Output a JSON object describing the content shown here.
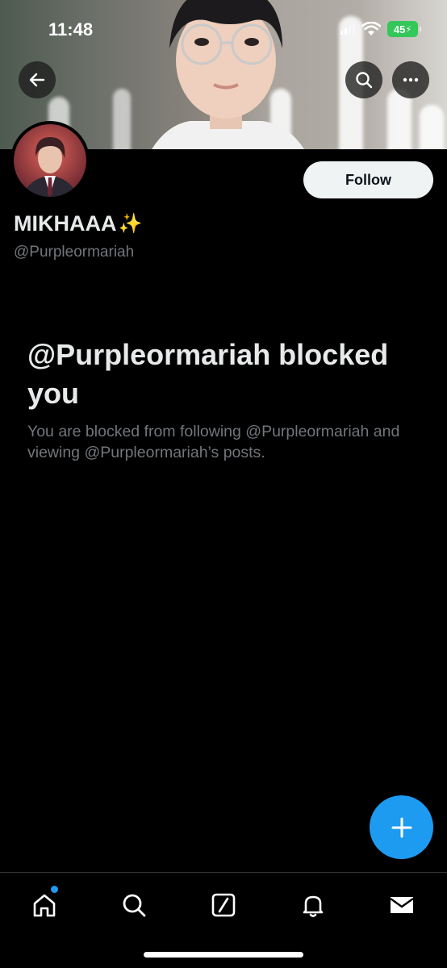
{
  "status_bar": {
    "time": "11:48",
    "battery": "45"
  },
  "profile": {
    "display_name": "MIKHAAA",
    "display_name_emoji": "✨",
    "handle": "@Purpleormariah",
    "follow_label": "Follow"
  },
  "blocked": {
    "title": "@Purpleormariah blocked you",
    "description": "You are blocked from following @Purpleormariah and viewing @Purpleormariah’s posts."
  },
  "header_icons": [
    "back-arrow-icon",
    "search-icon",
    "more-icon"
  ],
  "tab_bar": [
    "home-icon",
    "search-icon",
    "grok-icon",
    "bell-icon",
    "mail-icon"
  ],
  "colors": {
    "accent": "#1d9bf0",
    "background": "#000000",
    "secondary_text": "#71767b",
    "battery": "#34c759"
  }
}
